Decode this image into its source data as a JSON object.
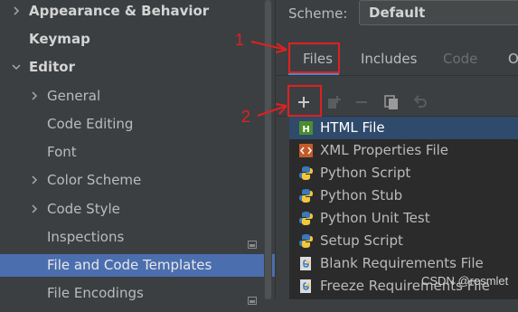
{
  "tree": {
    "items": [
      {
        "label": "Appearance & Behavior",
        "expander": "chevron-right",
        "bold": true
      },
      {
        "label": "Keymap",
        "expander": "",
        "bold": true
      },
      {
        "label": "Editor",
        "expander": "chevron-down",
        "bold": true
      },
      {
        "label": "General",
        "expander": "chevron-right",
        "bold": false
      },
      {
        "label": "Code Editing",
        "expander": "",
        "bold": false
      },
      {
        "label": "Font",
        "expander": "",
        "bold": false
      },
      {
        "label": "Color Scheme",
        "expander": "chevron-right",
        "bold": false
      },
      {
        "label": "Code Style",
        "expander": "chevron-right",
        "bold": false
      },
      {
        "label": "Inspections",
        "expander": "",
        "bold": false,
        "page_icon": true
      },
      {
        "label": "File and Code Templates",
        "expander": "",
        "bold": false,
        "selected": true,
        "page_icon": true
      },
      {
        "label": "File Encodings",
        "expander": "",
        "bold": false,
        "page_icon": true
      }
    ]
  },
  "scheme": {
    "label": "Scheme:",
    "value": "Default"
  },
  "tabs": [
    {
      "label": "Files",
      "active": true
    },
    {
      "label": "Includes",
      "active": false
    },
    {
      "label": "Code",
      "active": false,
      "disabled": true
    },
    {
      "label": "Ot",
      "active": false,
      "disabled": true
    }
  ],
  "toolbar": [
    "add-icon",
    "copy-template-icon",
    "remove-icon",
    "duplicate-icon",
    "reset-icon"
  ],
  "files": [
    {
      "label": "HTML File",
      "icon": "html-file-icon",
      "selected": true
    },
    {
      "label": "XML Properties File",
      "icon": "xml-file-icon"
    },
    {
      "label": "Python Script",
      "icon": "python-file-icon"
    },
    {
      "label": "Python Stub",
      "icon": "python-file-icon"
    },
    {
      "label": "Python Unit Test",
      "icon": "python-file-icon"
    },
    {
      "label": "Setup Script",
      "icon": "python-file-icon"
    },
    {
      "label": "Blank Requirements File",
      "icon": "requirements-file-icon"
    },
    {
      "label": "Freeze Requirements File",
      "icon": "requirements-file-icon"
    }
  ],
  "annotations": {
    "label1": "1",
    "label2": "2"
  },
  "watermark": "CSDN @resmlet",
  "colors": {
    "accent": "#4a88c7",
    "selection": "#4b6eaf",
    "annotation": "#e02020"
  }
}
